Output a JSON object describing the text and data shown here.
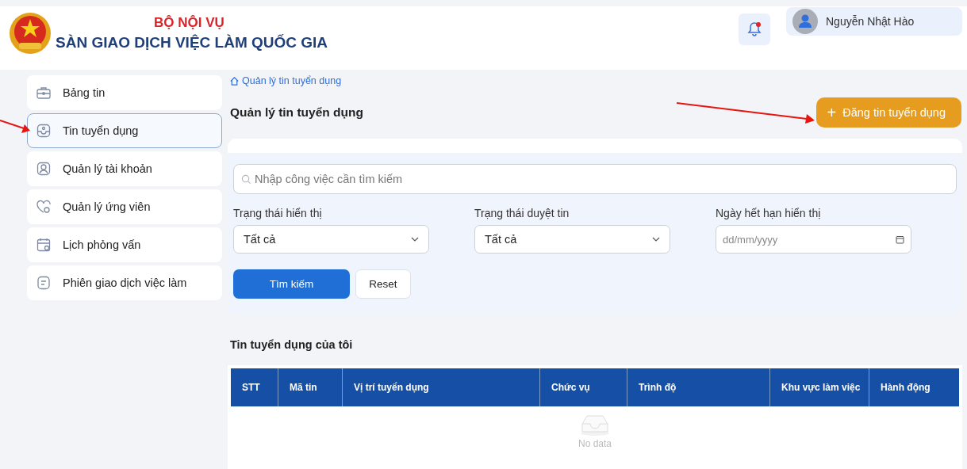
{
  "header": {
    "ministry": "BỘ NỘI VỤ",
    "title": "SÀN GIAO DỊCH VIỆC LÀM QUỐC GIA",
    "notification": {
      "unread": true
    },
    "user": {
      "name": "Nguyễn Nhật Hào"
    }
  },
  "sidebar": {
    "items": [
      {
        "label": "Bảng tin",
        "selected": false
      },
      {
        "label": "Tin tuyển dụng",
        "selected": true
      },
      {
        "label": "Quản lý tài khoản",
        "selected": false
      },
      {
        "label": "Quản lý ứng viên",
        "selected": false
      },
      {
        "label": "Lịch phỏng vấn",
        "selected": false
      },
      {
        "label": "Phiên giao dịch việc làm",
        "selected": false
      }
    ]
  },
  "breadcrumb": "Quản lý tin tuyển dụng",
  "page_title": "Quản lý tin tuyển dụng",
  "post_button": {
    "icon": "+",
    "label": "Đăng tin tuyển dụng"
  },
  "filters": {
    "search": {
      "placeholder": "Nhập công việc cần tìm kiếm"
    },
    "fields": [
      {
        "kind": "select",
        "label": "Trạng thái hiển thị",
        "value": "Tất cả"
      },
      {
        "kind": "select",
        "label": "Trạng thái duyệt tin",
        "value": "Tất cả"
      },
      {
        "kind": "date",
        "label": "Ngày hết hạn hiển thị",
        "placeholder": "dd/mm/yyyy"
      }
    ],
    "buttons": [
      {
        "kind": "primary",
        "label": "Tìm kiếm"
      },
      {
        "kind": "secondary",
        "label": "Reset"
      }
    ]
  },
  "table": {
    "title": "Tin tuyển dụng của tôi",
    "columns": [
      "STT",
      "Mã tin",
      "Vị trí tuyển dụng",
      "Chức vụ",
      "Trình độ",
      "Khu vực làm việc",
      "Hành động"
    ],
    "empty_text": "No data"
  }
}
